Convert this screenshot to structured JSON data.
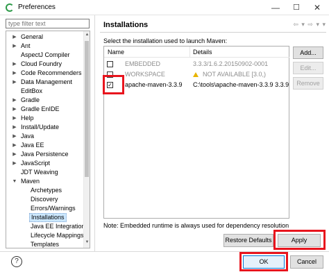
{
  "window": {
    "title": "Preferences",
    "minimize_glyph": "—",
    "maximize_glyph": "☐",
    "close_glyph": "✕"
  },
  "sidebar": {
    "filter_placeholder": "type filter text",
    "items": [
      {
        "label": "General",
        "expanded": false,
        "level": 0
      },
      {
        "label": "Ant",
        "expanded": false,
        "level": 0
      },
      {
        "label": "AspectJ Compiler",
        "expanded": null,
        "level": 0
      },
      {
        "label": "Cloud Foundry",
        "expanded": false,
        "level": 0
      },
      {
        "label": "Code Recommenders",
        "expanded": false,
        "level": 0
      },
      {
        "label": "Data Management",
        "expanded": false,
        "level": 0
      },
      {
        "label": "EditBox",
        "expanded": null,
        "level": 0
      },
      {
        "label": "Gradle",
        "expanded": false,
        "level": 0
      },
      {
        "label": "Gradle EnIDE",
        "expanded": false,
        "level": 0
      },
      {
        "label": "Help",
        "expanded": false,
        "level": 0
      },
      {
        "label": "Install/Update",
        "expanded": false,
        "level": 0
      },
      {
        "label": "Java",
        "expanded": false,
        "level": 0
      },
      {
        "label": "Java EE",
        "expanded": false,
        "level": 0
      },
      {
        "label": "Java Persistence",
        "expanded": false,
        "level": 0
      },
      {
        "label": "JavaScript",
        "expanded": false,
        "level": 0
      },
      {
        "label": "JDT Weaving",
        "expanded": null,
        "level": 0
      },
      {
        "label": "Maven",
        "expanded": true,
        "level": 0
      },
      {
        "label": "Archetypes",
        "expanded": null,
        "level": 1
      },
      {
        "label": "Discovery",
        "expanded": null,
        "level": 1
      },
      {
        "label": "Errors/Warnings",
        "expanded": null,
        "level": 1
      },
      {
        "label": "Installations",
        "expanded": null,
        "level": 1,
        "selected": true
      },
      {
        "label": "Java EE Integration",
        "expanded": null,
        "level": 1
      },
      {
        "label": "Lifecycle Mappings",
        "expanded": null,
        "level": 1
      },
      {
        "label": "Templates",
        "expanded": null,
        "level": 1
      }
    ]
  },
  "main": {
    "title": "Installations",
    "nav_glyphs": "⇦ ▾ ⇨ ▾ ▾",
    "description": "Select the installation used to launch Maven:",
    "table": {
      "columns": [
        "Name",
        "Details"
      ],
      "rows": [
        {
          "checked": false,
          "disabled": true,
          "name": "EMBEDDED",
          "details": "3.3.3/1.6.2.20150902-0001",
          "warning": false
        },
        {
          "checked": false,
          "disabled": true,
          "name": "WORKSPACE",
          "details": "NOT AVAILABLE [3.0,)",
          "warning": true
        },
        {
          "checked": true,
          "disabled": false,
          "name": "apache-maven-3.3.9",
          "details": "C:\\tools\\apache-maven-3.3.9 3.3.9",
          "warning": false
        }
      ]
    },
    "buttons": {
      "add": "Add...",
      "edit": "Edit...",
      "remove": "Remove"
    },
    "note": "Note: Embedded runtime is always used for dependency resolution",
    "restore_defaults": "Restore Defaults",
    "apply": "Apply"
  },
  "footer": {
    "help_glyph": "?",
    "ok": "OK",
    "cancel": "Cancel"
  },
  "colors": {
    "highlight": "#e8141d",
    "selection": "#cce8ff",
    "default_button": "#0078d7"
  }
}
